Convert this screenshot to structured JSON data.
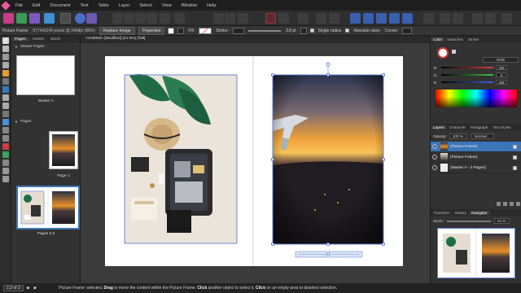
{
  "menubar": {
    "items": [
      "File",
      "Edit",
      "Document",
      "Text",
      "Table",
      "Layer",
      "Select",
      "View",
      "Window",
      "Help"
    ]
  },
  "context": {
    "selection": "Picture Frame",
    "info": "5774x5249 pixels @ 340dpi (88%)",
    "replace_image": "Replace Image",
    "properties": "Properties",
    "fill_label": "Fill:",
    "stroke_label": "Stroke:",
    "stroke_value": "3.8 pt",
    "single_radius": "Single radius",
    "absolute_sizes": "Absolute sizes",
    "corner_label": "Corner:"
  },
  "pages_panel": {
    "tabs": [
      "Pages",
      "Assets",
      "Stock"
    ],
    "master_section": "Master Pages",
    "master_label": "Master A",
    "pages_section": "Pages",
    "page1_label": "Page 1",
    "spread_label": "Pages 2,3"
  },
  "document": {
    "tab_title": "<Untitled> [Modified] (21.0%) [Tall]"
  },
  "color_panel": {
    "tabs": [
      "Color",
      "Swatches",
      "Stroke"
    ],
    "mode": "RGB",
    "channels": [
      {
        "label": "R",
        "value": "255",
        "fraction": 0.92,
        "color": "#e04040"
      },
      {
        "label": "G",
        "value": "0",
        "fraction": 0.93,
        "color": "#40c040"
      },
      {
        "label": "B",
        "value": "255",
        "fraction": 0.98,
        "color": "#4060e0"
      }
    ]
  },
  "layers_panel": {
    "tabs": [
      "Layers",
      "Character",
      "Paragraph",
      "Text Styles"
    ],
    "opacity_label": "Opacity:",
    "opacity_value": "100 %",
    "blend_mode": "Normal",
    "layers": [
      {
        "name": "(Picture Frame)",
        "selected": true
      },
      {
        "name": "(Picture Frame)",
        "selected": false
      },
      {
        "name": "(Master A - 2 Pages)",
        "selected": false
      }
    ]
  },
  "navigator_panel": {
    "tabs": [
      "Transform",
      "History",
      "Navigator"
    ],
    "zoom_label": "Zoom:",
    "zoom_value": "21 %"
  },
  "status": {
    "page": "2,3 of 3",
    "message_parts": [
      {
        "text": "'Picture Frame' selected. ",
        "bold": false
      },
      {
        "text": "Drag",
        "bold": true
      },
      {
        "text": " to move the content within the Picture Frame. ",
        "bold": false
      },
      {
        "text": "Click",
        "bold": true
      },
      {
        "text": " another object to select it. ",
        "bold": false
      },
      {
        "text": "Click",
        "bold": true
      },
      {
        "text": " on an empty area to deselect selection.",
        "bold": false
      }
    ]
  },
  "colors": {
    "accent": "#3a76b8",
    "selection_blue": "#5b7fd6",
    "brand": "#e85a9c"
  }
}
